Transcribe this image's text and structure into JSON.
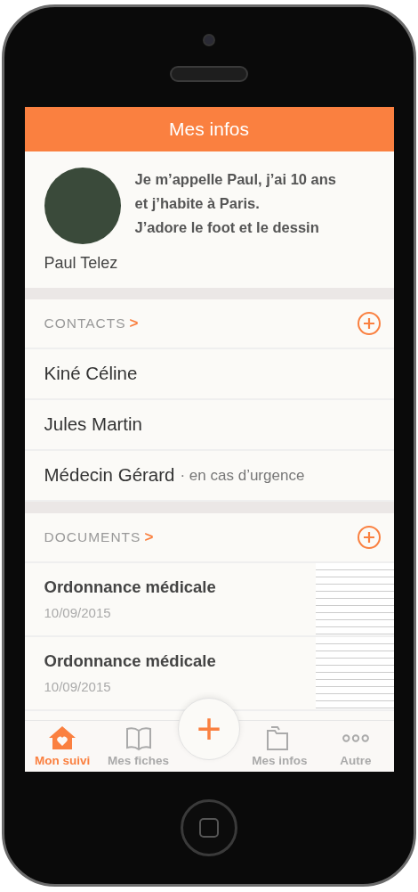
{
  "header": {
    "title": "Mes infos"
  },
  "profile": {
    "bio_lines": [
      "Je m’appelle Paul, j’ai 10 ans",
      "et j’habite à Paris.",
      "J’adore le foot et le dessin"
    ],
    "name": "Paul Telez"
  },
  "contacts": {
    "title": "CONTACTS",
    "chevron": ">",
    "items": [
      {
        "name": "Kiné Céline"
      },
      {
        "name": "Jules Martin"
      },
      {
        "name": "Médecin Gérard",
        "note": "· en cas d’urgence"
      }
    ]
  },
  "documents": {
    "title": "DOCUMENTS",
    "chevron": ">",
    "items": [
      {
        "title": "Ordonnance médicale",
        "date": "10/09/2015"
      },
      {
        "title": "Ordonnance médicale",
        "date": "10/09/2015"
      }
    ]
  },
  "tab_bar": [
    {
      "kind": "home",
      "label": "Mon suivi",
      "selected": true
    },
    {
      "kind": "book",
      "label": "Mes fiches",
      "selected": false
    },
    {
      "kind": "add",
      "label": "+"
    },
    {
      "kind": "folders",
      "label": "Mes infos",
      "selected": false
    },
    {
      "kind": "dots",
      "label": "Autre",
      "selected": false
    }
  ]
}
